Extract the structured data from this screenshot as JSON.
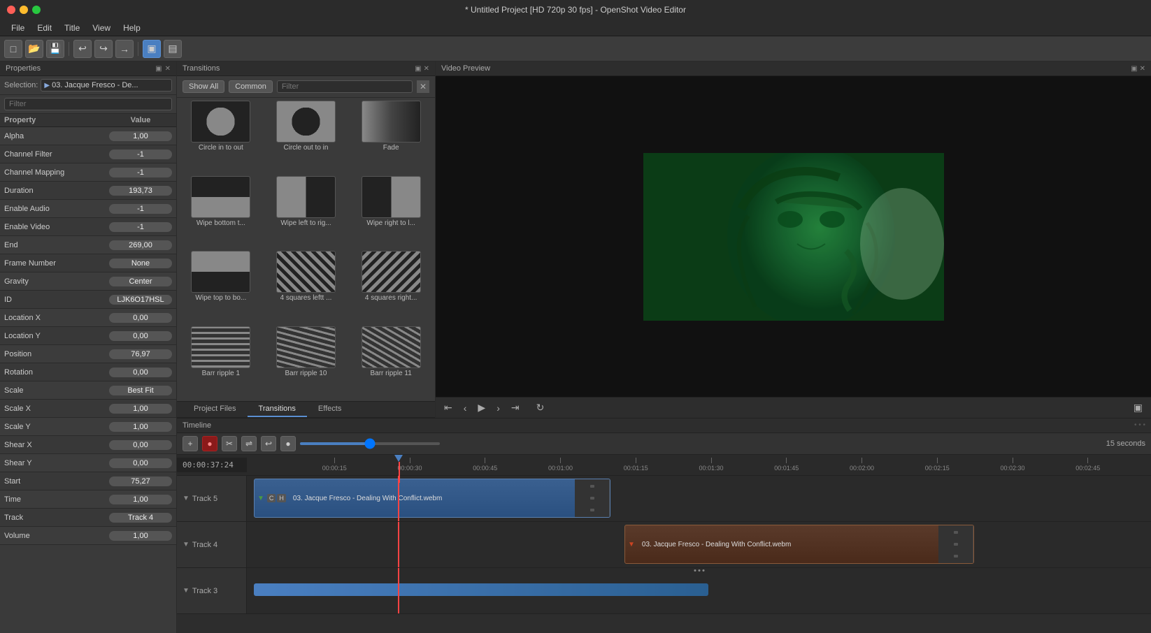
{
  "window": {
    "title": "* Untitled Project [HD 720p 30 fps] - OpenShot Video Editor"
  },
  "menubar": {
    "items": [
      "File",
      "Edit",
      "Title",
      "View",
      "Help"
    ]
  },
  "toolbar": {
    "buttons": [
      "new",
      "open",
      "save",
      "undo",
      "redo",
      "import"
    ]
  },
  "properties": {
    "panel_title": "Properties",
    "selection_label": "Selection:",
    "selection_value": "03. Jacque Fresco - De...",
    "filter_placeholder": "Filter",
    "columns": {
      "property": "Property",
      "value": "Value"
    },
    "rows": [
      {
        "name": "Alpha",
        "value": "1,00"
      },
      {
        "name": "Channel Filter",
        "value": "-1"
      },
      {
        "name": "Channel Mapping",
        "value": "-1"
      },
      {
        "name": "Duration",
        "value": "193,73"
      },
      {
        "name": "Enable Audio",
        "value": "-1"
      },
      {
        "name": "Enable Video",
        "value": "-1"
      },
      {
        "name": "End",
        "value": "269,00"
      },
      {
        "name": "Frame Number",
        "value": "None"
      },
      {
        "name": "Gravity",
        "value": "Center"
      },
      {
        "name": "ID",
        "value": "LJK6O17HSL"
      },
      {
        "name": "Location X",
        "value": "0,00"
      },
      {
        "name": "Location Y",
        "value": "0,00"
      },
      {
        "name": "Position",
        "value": "76,97"
      },
      {
        "name": "Rotation",
        "value": "0,00"
      },
      {
        "name": "Scale",
        "value": "Best Fit"
      },
      {
        "name": "Scale X",
        "value": "1,00"
      },
      {
        "name": "Scale Y",
        "value": "1,00"
      },
      {
        "name": "Shear X",
        "value": "0,00"
      },
      {
        "name": "Shear Y",
        "value": "0,00"
      },
      {
        "name": "Start",
        "value": "75,27"
      },
      {
        "name": "Time",
        "value": "1,00"
      },
      {
        "name": "Track",
        "value": "Track 4"
      },
      {
        "name": "Volume",
        "value": "1,00"
      }
    ]
  },
  "transitions": {
    "panel_title": "Transitions",
    "btn_show_all": "Show All",
    "btn_common": "Common",
    "filter_placeholder": "Filter",
    "items": [
      {
        "label": "Circle in to out",
        "thumb_class": "thumb-circle-in-out"
      },
      {
        "label": "Circle out to in",
        "thumb_class": "thumb-circle-out-in"
      },
      {
        "label": "Fade",
        "thumb_class": "thumb-fade"
      },
      {
        "label": "Wipe bottom t...",
        "thumb_class": "thumb-wipe-bottom"
      },
      {
        "label": "Wipe left to rig...",
        "thumb_class": "thumb-wipe-left"
      },
      {
        "label": "Wipe right to l...",
        "thumb_class": "thumb-wipe-right"
      },
      {
        "label": "Wipe top to bo...",
        "thumb_class": "thumb-wipe-top"
      },
      {
        "label": "4 squares leftt ...",
        "thumb_class": "thumb-4squares-left"
      },
      {
        "label": "4 squares right...",
        "thumb_class": "thumb-4squares-right"
      },
      {
        "label": "Barr ripple 1",
        "thumb_class": "thumb-barr1"
      },
      {
        "label": "Barr ripple 10",
        "thumb_class": "thumb-barr10"
      },
      {
        "label": "Barr ripple 11",
        "thumb_class": "thumb-barr11"
      }
    ]
  },
  "bottom_tabs": [
    {
      "label": "Project Files",
      "active": false
    },
    {
      "label": "Transitions",
      "active": false
    },
    {
      "label": "Effects",
      "active": true
    }
  ],
  "video_preview": {
    "panel_title": "Video Preview"
  },
  "timeline": {
    "header": "Timeline",
    "timecode": "00:00:37:24",
    "zoom_label": "15 seconds",
    "marks": [
      "00:00:15",
      "00:00:30",
      "00:00:45",
      "00:01:00",
      "00:01:15",
      "00:01:30",
      "00:01:45",
      "00:02:00",
      "00:02:15",
      "00:02:30",
      "00:02:45"
    ],
    "tracks": [
      {
        "name": "Track 5",
        "clip_label": "03. Jacque Fresco - Dealing With Conflict.webm",
        "clip_type": "blue",
        "has_badges": true,
        "badge_c": "C",
        "badge_h": "H"
      },
      {
        "name": "Track 4",
        "clip_label": "03. Jacque Fresco - Dealing With Conflict.webm",
        "clip_type": "dark",
        "has_badges": false
      },
      {
        "name": "Track 3",
        "clip_type": "bar"
      }
    ]
  }
}
